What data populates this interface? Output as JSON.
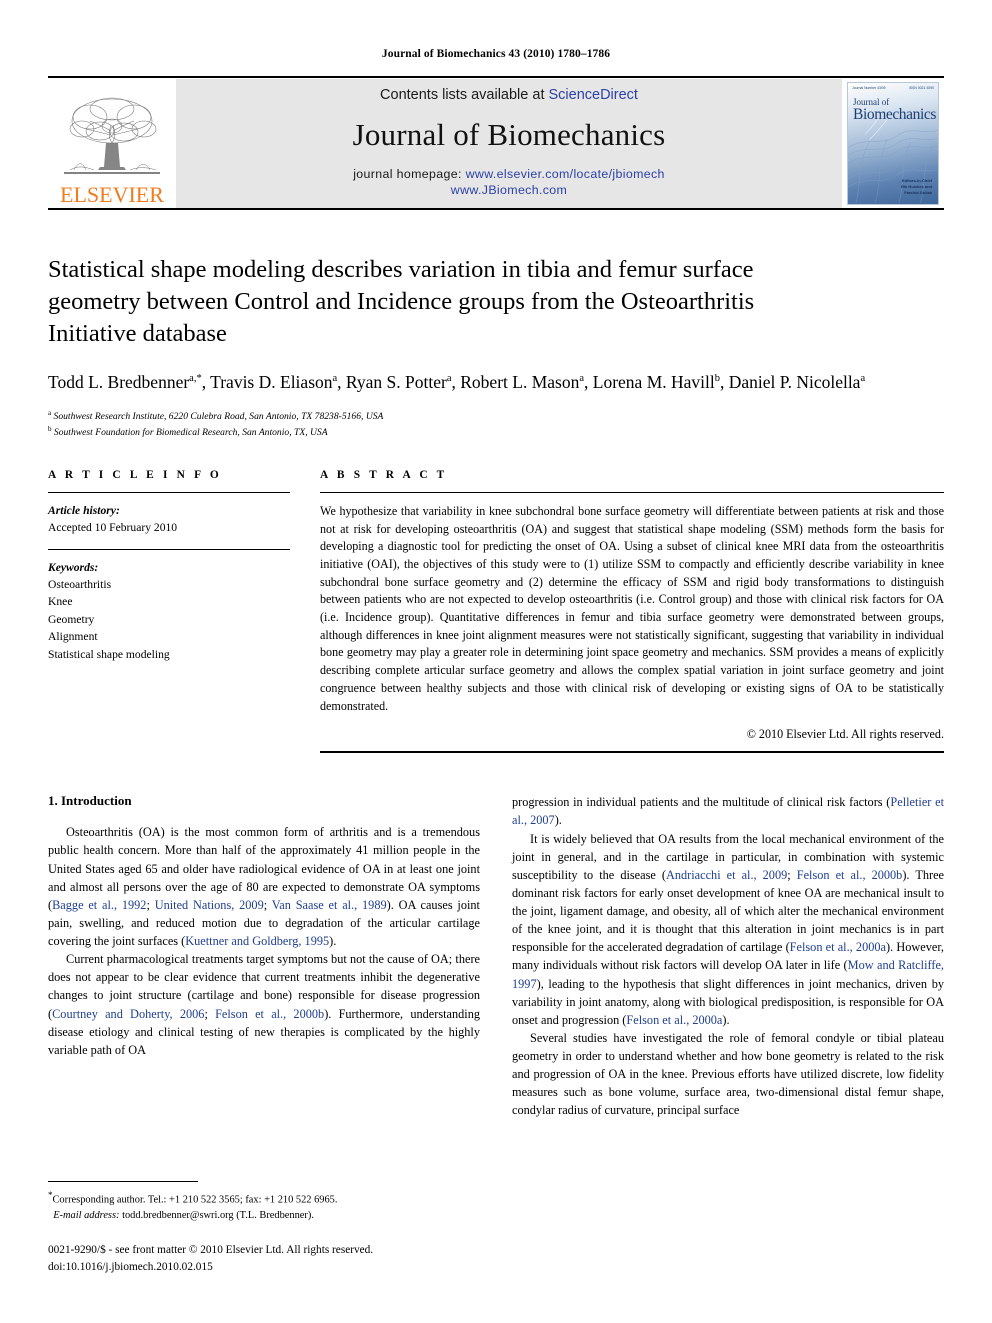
{
  "running_head": "Journal of Biomechanics 43 (2010) 1780–1786",
  "masthead": {
    "publisher_name": "ELSEVIER",
    "contents_prefix": "Contents lists available at ",
    "contents_link": "ScienceDirect",
    "journal_name": "Journal of Biomechanics",
    "homepage_prefix": "journal homepage: ",
    "homepage_url": "www.elsevier.com/locate/jbiomech",
    "homepage_url2": "www.JBiomech.com",
    "cover": {
      "top_left": "Journal Number 43/09",
      "top_right": "ISSN 0021-9290",
      "title_line1": "Journal of",
      "title_line2": "Biomechanics",
      "foot_line1": "Editors-in-Chief",
      "foot_line2": "Rik Huiskes and",
      "foot_line3": "Farshid Guilak"
    }
  },
  "article": {
    "title": "Statistical shape modeling describes variation in tibia and femur surface geometry between Control and Incidence groups from the Osteoarthritis Initiative database",
    "authors": "Todd L. Bredbenner a,*, Travis D. Eliason a, Ryan S. Potter a, Robert L. Mason a, Lorena M. Havill b, Daniel P. Nicolella a",
    "affiliation_a": "Southwest Research Institute, 6220 Culebra Road, San Antonio, TX 78238-5166, USA",
    "affiliation_b": "Southwest Foundation for Biomedical Research, San Antonio, TX, USA"
  },
  "article_info": {
    "heading": "A R T I C L E   I N F O",
    "history_label": "Article history:",
    "history_value": "Accepted 10 February 2010",
    "keywords_label": "Keywords:",
    "keywords": [
      "Osteoarthritis",
      "Knee",
      "Geometry",
      "Alignment",
      "Statistical shape modeling"
    ]
  },
  "abstract": {
    "heading": "A B S T R A C T",
    "text": "We hypothesize that variability in knee subchondral bone surface geometry will differentiate between patients at risk and those not at risk for developing osteoarthritis (OA) and suggest that statistical shape modeling (SSM) methods form the basis for developing a diagnostic tool for predicting the onset of OA. Using a subset of clinical knee MRI data from the osteoarthritis initiative (OAI), the objectives of this study were to (1) utilize SSM to compactly and efficiently describe variability in knee subchondral bone surface geometry and (2) determine the efficacy of SSM and rigid body transformations to distinguish between patients who are not expected to develop osteoarthritis (i.e. Control group) and those with clinical risk factors for OA (i.e. Incidence group). Quantitative differences in femur and tibia surface geometry were demonstrated between groups, although differences in knee joint alignment measures were not statistically significant, suggesting that variability in individual bone geometry may play a greater role in determining joint space geometry and mechanics. SSM provides a means of explicitly describing complete articular surface geometry and allows the complex spatial variation in joint surface geometry and joint congruence between healthy subjects and those with clinical risk of developing or existing signs of OA to be statistically demonstrated.",
    "copyright": "© 2010 Elsevier Ltd. All rights reserved."
  },
  "introduction": {
    "heading": "1. Introduction",
    "left_paragraphs": [
      "Osteoarthritis (OA) is the most common form of arthritis and is a tremendous public health concern. More than half of the approximately 41 million people in the United States aged 65 and older have radiological evidence of OA in at least one joint and almost all persons over the age of 80 are expected to demonstrate OA symptoms (Bagge et al., 1992; United Nations, 2009; Van Saase et al., 1989). OA causes joint pain, swelling, and reduced motion due to degradation of the articular cartilage covering the joint surfaces (Kuettner and Goldberg, 1995).",
      "Current pharmacological treatments target symptoms but not the cause of OA; there does not appear to be clear evidence that current treatments inhibit the degenerative changes to joint structure (cartilage and bone) responsible for disease progression (Courtney and Doherty, 2006; Felson et al., 2000b). Furthermore, understanding disease etiology and clinical testing of new therapies is complicated by the highly variable path of OA"
    ],
    "right_paragraphs": [
      "progression in individual patients and the multitude of clinical risk factors (Pelletier et al., 2007).",
      "It is widely believed that OA results from the local mechanical environment of the joint in general, and in the cartilage in particular, in combination with systemic susceptibility to the disease (Andriacchi et al., 2009; Felson et al., 2000b). Three dominant risk factors for early onset development of knee OA are mechanical insult to the joint, ligament damage, and obesity, all of which alter the mechanical environment of the knee joint, and it is thought that this alteration in joint mechanics is in part responsible for the accelerated degradation of cartilage (Felson et al., 2000a). However, many individuals without risk factors will develop OA later in life (Mow and Ratcliffe, 1997), leading to the hypothesis that slight differences in joint mechanics, driven by variability in joint anatomy, along with biological predisposition, is responsible for OA onset and progression (Felson et al., 2000a).",
      "Several studies have investigated the role of femoral condyle or tibial plateau geometry in order to understand whether and how bone geometry is related to the risk and progression of OA in the knee. Previous efforts have utilized discrete, low fidelity measures such as bone volume, surface area, two-dimensional distal femur shape, condylar radius of curvature, principal surface"
    ]
  },
  "footnotes": {
    "corresponding": "Corresponding author. Tel.: +1 210 522 3565; fax: +1 210 522 6965.",
    "email_label": "E-mail address:",
    "email_value": "todd.bredbenner@swri.org (T.L. Bredbenner).",
    "issn_line": "0021-9290/$ - see front matter © 2010 Elsevier Ltd. All rights reserved.",
    "doi_line": "doi:10.1016/j.jbiomech.2010.02.015"
  },
  "colors": {
    "link_blue": "#2b40a8",
    "citation_blue": "#1f3f8f",
    "elsevier_orange": "#f07c1d",
    "banner_grey": "#e6e6e6"
  }
}
